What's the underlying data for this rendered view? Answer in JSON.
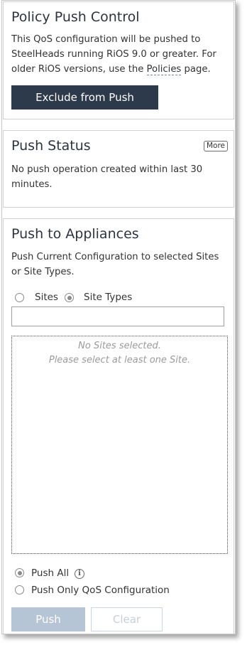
{
  "policy_push": {
    "title": "Policy Push Control",
    "desc_line1": "This QoS configuration will be pushed to",
    "desc_line2": "SteelHeads running RiOS 9.0 or greater. For",
    "desc_line3_prefix": "older RiOS versions, use the ",
    "desc_link": "Policies",
    "desc_line3_suffix": " page.",
    "exclude_button": "Exclude from Push"
  },
  "push_status": {
    "title": "Push Status",
    "more_button": "More",
    "message_line1": "No push operation created within last 30",
    "message_line2": "minutes."
  },
  "push_to_appliances": {
    "title": "Push to Appliances",
    "desc_line1": "Push Current Configuration to selected Sites",
    "desc_line2": "or Site Types.",
    "target_options": [
      {
        "label": "Sites",
        "selected": false
      },
      {
        "label": "Site Types",
        "selected": true
      }
    ],
    "search_value": "",
    "empty_line1": "No Sites selected.",
    "empty_line2": "Please select at least one Site.",
    "push_mode_options": [
      {
        "label": "Push All",
        "selected": true
      },
      {
        "label": "Push Only QoS Configuration",
        "selected": false
      }
    ],
    "push_button": "Push",
    "clear_button": "Clear"
  },
  "colors": {
    "dark_button": "#2c3a4c",
    "disabled_button": "#b5c5d6",
    "title_text": "#2c3440"
  },
  "icons": {
    "info": "info-icon"
  }
}
